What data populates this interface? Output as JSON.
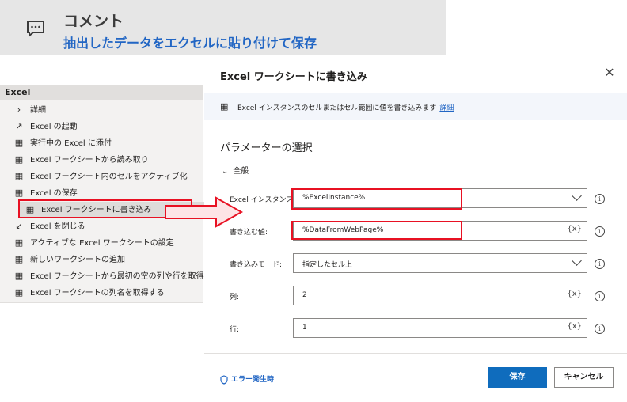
{
  "comment": {
    "title": "コメント",
    "body": "抽出したデータをエクセルに貼り付けて保存",
    "icon": "comment-icon"
  },
  "sidebar": {
    "header": "Excel",
    "items": [
      {
        "label": "詳細",
        "icon": "chevron-right-icon"
      },
      {
        "label": "Excel の起動",
        "icon": "launch-arrow-icon"
      },
      {
        "label": "実行中の Excel に添付",
        "icon": "excel-icon"
      },
      {
        "label": "Excel ワークシートから読み取り",
        "icon": "excel-icon"
      },
      {
        "label": "Excel ワークシート内のセルをアクティブ化",
        "icon": "excel-icon"
      },
      {
        "label": "Excel の保存",
        "icon": "excel-icon"
      },
      {
        "label": "Excel ワークシートに書き込み",
        "icon": "excel-icon",
        "selected": true
      },
      {
        "label": "Excel を閉じる",
        "icon": "close-arrow-icon"
      },
      {
        "label": "アクティブな Excel ワークシートの設定",
        "icon": "excel-icon"
      },
      {
        "label": "新しいワークシートの追加",
        "icon": "excel-icon"
      },
      {
        "label": "Excel ワークシートから最初の空の列や行を取得",
        "icon": "excel-icon"
      },
      {
        "label": "Excel ワークシートの列名を取得する",
        "icon": "excel-icon"
      }
    ]
  },
  "dialog": {
    "title": "Excel ワークシートに書き込み",
    "info_text": "Excel インスタンスのセルまたはセル範囲に値を書き込みます",
    "info_link": "詳細",
    "params_heading": "パラメーターの選択",
    "section": "全般",
    "fields": [
      {
        "label": "Excel インスタンス:",
        "value": "%ExcelInstance%",
        "control": "dropdown"
      },
      {
        "label": "書き込む値:",
        "value": "%DataFromWebPage%",
        "control": "text",
        "suffix": "{x}"
      },
      {
        "label": "書き込みモード:",
        "value": "指定したセル上",
        "control": "dropdown"
      },
      {
        "label": "列:",
        "value": "2",
        "control": "text",
        "suffix": "{x}"
      },
      {
        "label": "行:",
        "value": "1",
        "control": "text",
        "suffix": "{x}"
      }
    ],
    "error_label": "エラー発生時",
    "save_label": "保存",
    "cancel_label": "キャンセル"
  },
  "colors": {
    "accent": "#0f6cbd",
    "link": "#2266c4",
    "highlight": "#e81123"
  }
}
